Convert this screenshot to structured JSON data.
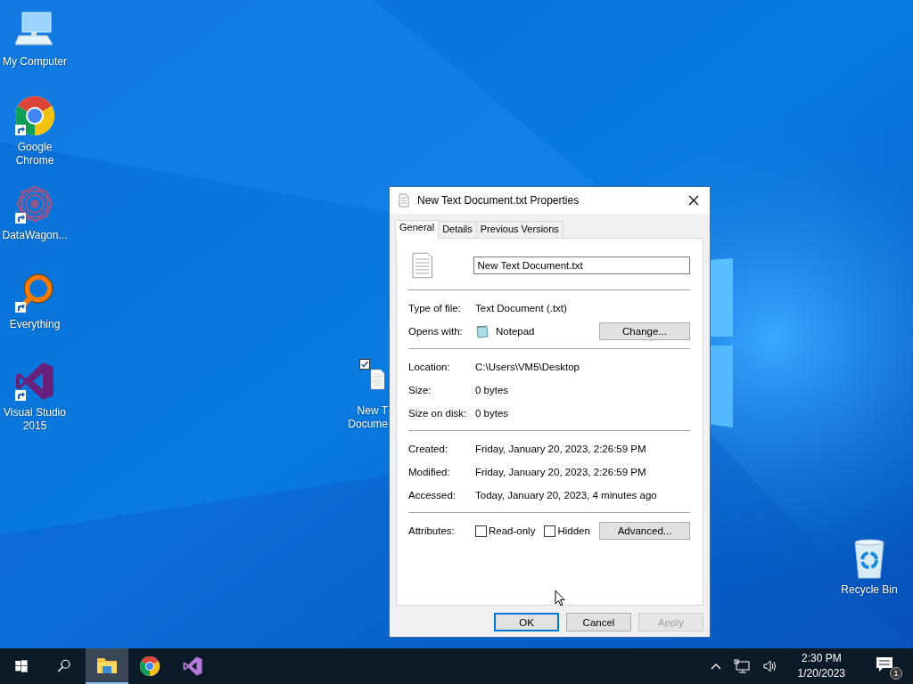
{
  "desktop_icons": [
    {
      "label": "My Computer",
      "kind": "computer",
      "shortcut": false,
      "checked": false
    },
    {
      "label": "Google Chrome",
      "kind": "chrome",
      "shortcut": true,
      "checked": false
    },
    {
      "label": "DataWagon...",
      "kind": "datawagon",
      "shortcut": true,
      "checked": false
    },
    {
      "label": "Everything",
      "kind": "everything",
      "shortcut": true,
      "checked": false
    },
    {
      "label": "Visual Studio 2015",
      "kind": "visualstudio",
      "shortcut": true,
      "checked": false
    },
    {
      "label": "New T Docume",
      "kind": "document",
      "shortcut": false,
      "checked": true
    },
    {
      "label": "Recycle Bin",
      "kind": "recycle",
      "shortcut": false,
      "checked": false
    }
  ],
  "dialog": {
    "title": "New Text Document.txt Properties",
    "tabs": [
      {
        "label": "General",
        "selected": true
      },
      {
        "label": "Details",
        "selected": false
      },
      {
        "label": "Previous Versions",
        "selected": false
      }
    ],
    "file_name": {
      "value": "New Text Document.txt"
    },
    "sections": [
      [
        {
          "kind": "text",
          "label": "Type of file:",
          "value": "Text Document (.txt)"
        },
        {
          "kind": "app",
          "label": "Opens with:",
          "value": "Notepad",
          "button": "Change..."
        }
      ],
      [
        {
          "kind": "text",
          "label": "Location:",
          "value": "C:\\Users\\VM5\\Desktop"
        },
        {
          "kind": "text",
          "label": "Size:",
          "value": "0 bytes"
        },
        {
          "kind": "text",
          "label": "Size on disk:",
          "value": "0 bytes"
        }
      ],
      [
        {
          "kind": "text",
          "label": "Created:",
          "value": "Friday, January 20, 2023, 2:26:59 PM"
        },
        {
          "kind": "text",
          "label": "Modified:",
          "value": "Friday, January 20, 2023, 2:26:59 PM"
        },
        {
          "kind": "text",
          "label": "Accessed:",
          "value": "Today, January 20, 2023, 4 minutes ago"
        }
      ]
    ],
    "attributes": {
      "label": "Attributes:",
      "checkboxes": [
        {
          "label": "Read-only",
          "checked": false
        },
        {
          "label": "Hidden",
          "checked": false
        }
      ],
      "button": "Advanced..."
    },
    "buttons": [
      {
        "label": "OK",
        "default": true,
        "disabled": false
      },
      {
        "label": "Cancel",
        "default": false,
        "disabled": false
      },
      {
        "label": "Apply",
        "default": false,
        "disabled": true
      }
    ]
  },
  "taskbar": {
    "items": [
      {
        "kind": "start",
        "active": false
      },
      {
        "kind": "search",
        "active": false
      },
      {
        "kind": "explorer",
        "active": true
      },
      {
        "kind": "chrome",
        "active": false
      },
      {
        "kind": "visualstudio",
        "active": false
      }
    ],
    "clock": {
      "time": "2:30 PM",
      "date": "1/20/2023"
    },
    "notifications": {
      "count": "1"
    }
  }
}
